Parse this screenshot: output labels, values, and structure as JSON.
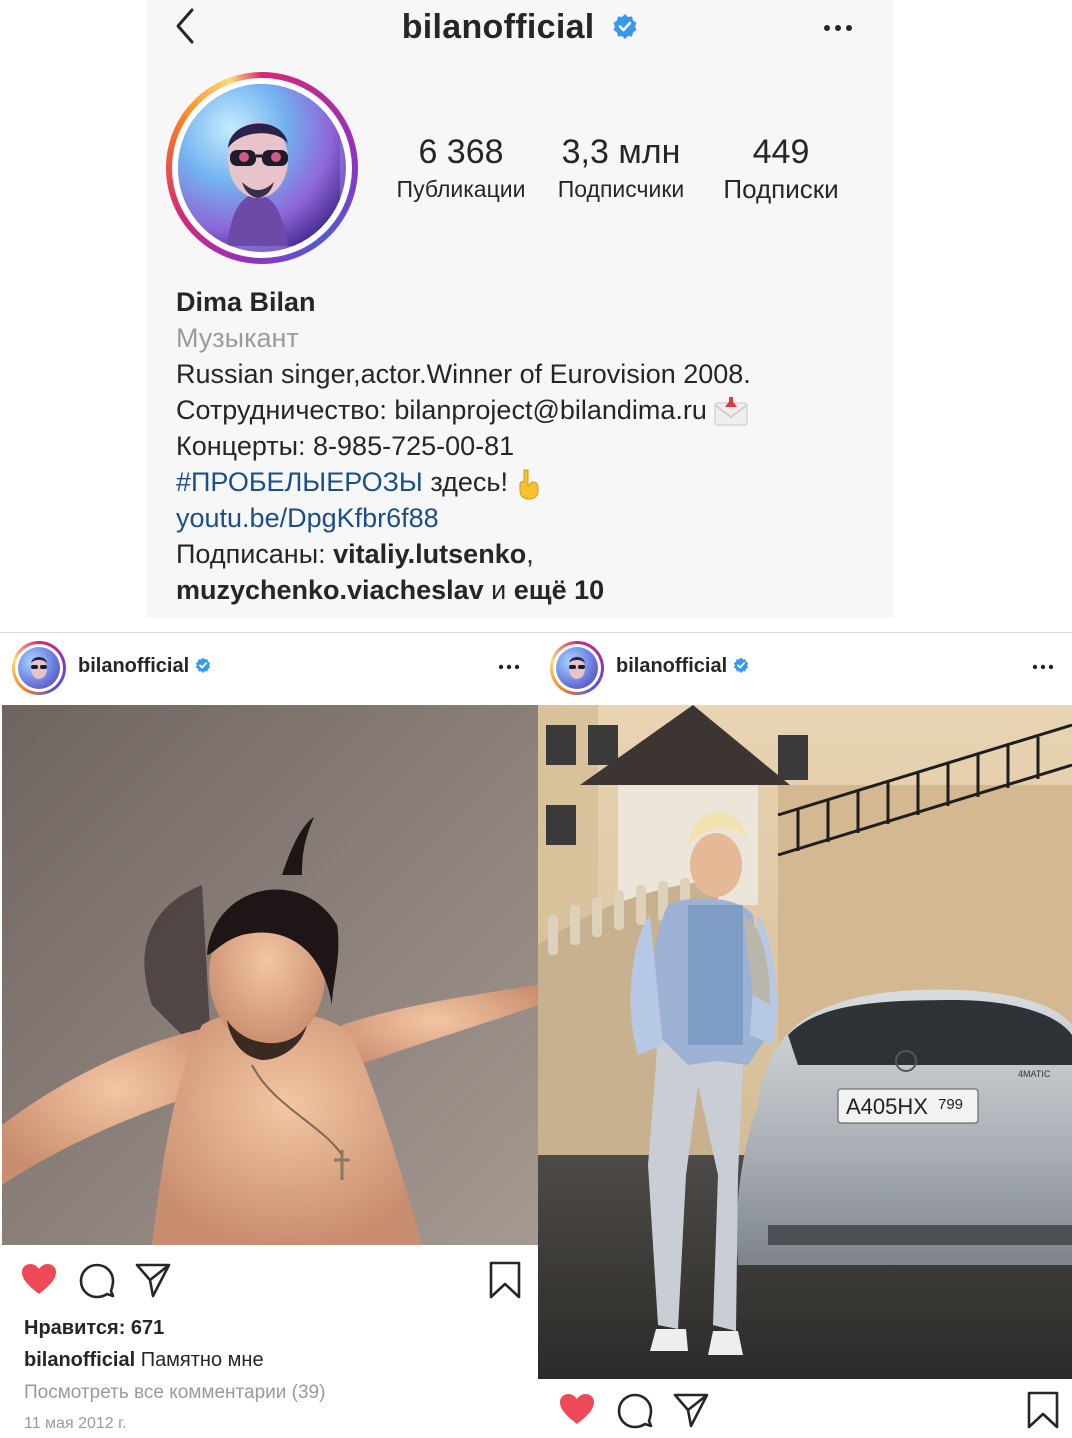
{
  "profile": {
    "username": "bilanofficial",
    "stats": {
      "posts_count": "6 368",
      "posts_label": "Публикации",
      "followers_count": "3,3 млн",
      "followers_label": "Подписчики",
      "following_count": "449",
      "following_label": "Подписки"
    },
    "bio": {
      "name": "Dima Bilan",
      "category": "Музыкант",
      "line1": "Russian singer,actor.Winner of Eurovision 2008.",
      "line2": "Сотрудничество: bilanproject@bilandima.ru",
      "line3": "Концерты: 8-985-725-00-81",
      "hashtag": "#ПРОБЕЛЫЕРОЗЫ",
      "hashtag_suffix": "здесь!",
      "link": "youtu.be/DpgKfbr6f88",
      "followed_by_prefix": "Подписаны:",
      "followed_by_user1": "vitaliy.lutsenko",
      "followed_by_user2": "muzychenko.viacheslav",
      "followed_by_and": "и",
      "followed_by_more": "ещё 10"
    }
  },
  "posts": [
    {
      "username": "bilanofficial",
      "likes": "Нравится: 671",
      "caption_user": "bilanofficial",
      "caption_text": "Памятно мне",
      "comments_link": "Посмотреть все комментарии (39)",
      "date": "11 мая 2012 г."
    },
    {
      "username": "bilanofficial",
      "plate": "А405НХ",
      "plate_region": "799",
      "car_badge": "4MATIC"
    }
  ],
  "colors": {
    "verified": "#3897f0",
    "liked_heart": "#ed4956",
    "link": "#1a4f8a",
    "secondary_text": "#9b9b9b"
  },
  "icons": [
    "back-icon",
    "verified-icon",
    "more-icon",
    "heart-icon",
    "comment-icon",
    "share-icon",
    "bookmark-icon",
    "envelope-emoji-icon",
    "pointing-down-emoji-icon"
  ]
}
